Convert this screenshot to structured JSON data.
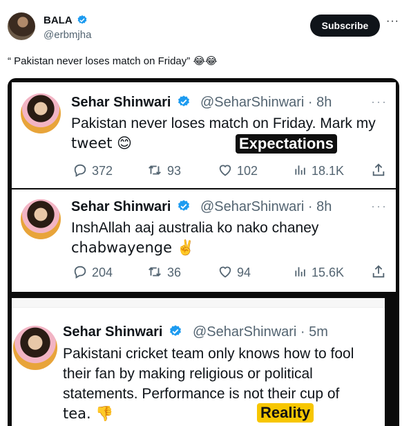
{
  "post": {
    "author_name": "BALA",
    "author_handle": "@erbmjha",
    "subscribe_label": "Subscribe",
    "more_label": "···",
    "text": "“ Pakistan never loses match on Friday” 😂😂"
  },
  "embedded": {
    "tweet1": {
      "name": "Sehar Shinwari",
      "handle": "@SeharShinwari · 8h",
      "more": "···",
      "line1": "Pakistan never loses match on Friday. Mark my",
      "line2": "tweet 😊",
      "label": "Expectations",
      "replies": "372",
      "retweets": "93",
      "likes": "102",
      "views": "18.1K"
    },
    "tweet2": {
      "name": "Sehar Shinwari",
      "handle": "@SeharShinwari · 8h",
      "more": "···",
      "line1": "InshAllah aaj australia ko nako chaney",
      "line2": "chabwayenge ✌️",
      "replies": "204",
      "retweets": "36",
      "likes": "94",
      "views": "15.6K"
    },
    "tweet3": {
      "name": "Sehar Shinwari",
      "handle": "@SeharShinwari · 5m",
      "line1": "Pakistani cricket team only knows how to fool",
      "line2": "their fan by making religious or political",
      "line3": "statements. Performance is not their cup of",
      "line4": "tea. 👎",
      "label": "Reality"
    }
  },
  "colors": {
    "text": "#0f1419",
    "muted": "#536471",
    "verified": "#1d9bf0",
    "expectations_bg": "#0f0f0f",
    "reality_bg": "#f7c600"
  },
  "icons": [
    "verified-badge-icon",
    "reply-icon",
    "retweet-icon",
    "like-icon",
    "views-icon",
    "share-icon",
    "more-icon"
  ]
}
